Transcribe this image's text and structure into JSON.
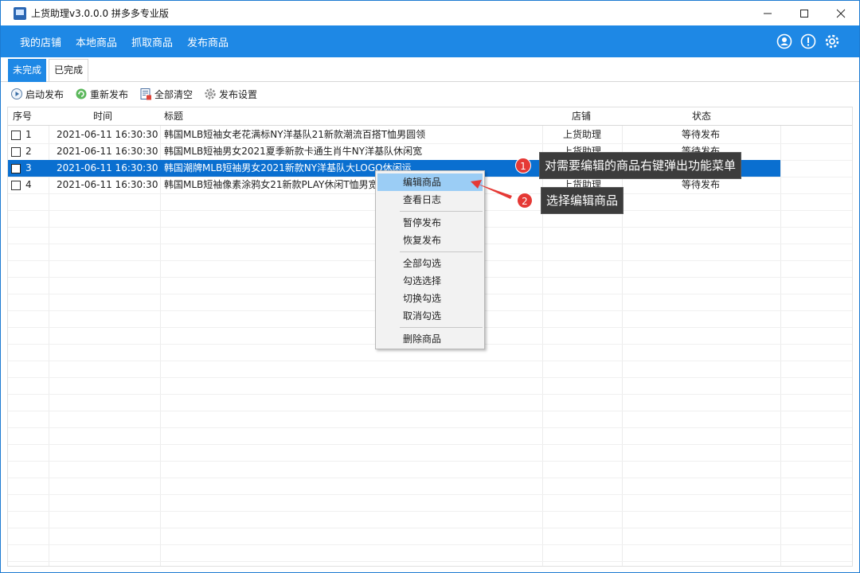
{
  "window": {
    "title": "上货助理v3.0.0.0 拼多多专业版",
    "controls": {
      "minimize": "─",
      "maximize": "☐",
      "close": "✕"
    }
  },
  "menu": {
    "items": [
      "我的店铺",
      "本地商品",
      "抓取商品",
      "发布商品"
    ],
    "icons": [
      "user-icon",
      "info-icon",
      "gear-icon"
    ],
    "bg_color": "#1e88e5"
  },
  "tabs": {
    "active": "未完成",
    "inactive": "已完成"
  },
  "toolbar": {
    "start": "启动发布",
    "republish": "重新发布",
    "clear": "全部清空",
    "settings": "发布设置"
  },
  "table": {
    "headers": {
      "index": "序号",
      "time": "时间",
      "title": "标题",
      "store": "店铺",
      "status": "状态"
    },
    "rows": [
      {
        "index": "1",
        "time": "2021-06-11 16:30:30",
        "title": "韩国MLB短袖女老花满标NY洋基队21新款潮流百搭T恤男圆领",
        "store": "上货助理",
        "status": "等待发布"
      },
      {
        "index": "2",
        "time": "2021-06-11 16:30:30",
        "title": "韩国MLB短袖男女2021夏季新款卡通生肖牛NY洋基队休闲宽",
        "store": "上货助理",
        "status": "等待发布"
      },
      {
        "index": "3",
        "time": "2021-06-11 16:30:30",
        "title": "韩国潮牌MLB短袖男女2021新款NY洋基队大LOGO休闲运",
        "store": "",
        "status": ""
      },
      {
        "index": "4",
        "time": "2021-06-11 16:30:30",
        "title": "韩国MLB短袖像素涂鸦女21新款PLAY休闲T恤男宽",
        "store": "上货助理",
        "status": "等待发布"
      }
    ],
    "selected_row": "3"
  },
  "context_menu": {
    "group1": [
      "编辑商品",
      "查看日志"
    ],
    "group2": [
      "暂停发布",
      "恢复发布"
    ],
    "group3": [
      "全部勾选",
      "勾选选择",
      "切换勾选",
      "取消勾选"
    ],
    "group4": [
      "删除商品"
    ],
    "highlighted": "编辑商品"
  },
  "annotations": {
    "step1": {
      "number": "1",
      "text": "对需要编辑的商品右键弹出功能菜单"
    },
    "step2": {
      "number": "2",
      "text": "选择编辑商品"
    },
    "color": "#e53935"
  }
}
